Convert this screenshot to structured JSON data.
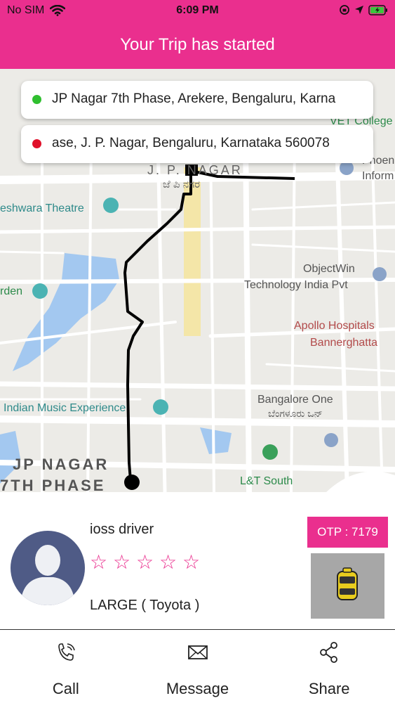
{
  "status_bar": {
    "carrier": "No SIM",
    "time": "6:09 PM"
  },
  "header": {
    "title": "Your Trip has started"
  },
  "trip": {
    "pickup_address": "JP Nagar 7th Phase, Arekere, Bengaluru, Karna",
    "drop_address": "ase, J. P. Nagar, Bengaluru, Karnataka 560078",
    "pickup_dot_color": "#2fbf2f",
    "drop_dot_color": "#e0102a"
  },
  "map": {
    "labels": {
      "jp_nagar": "J. P. NAGAR",
      "jp_nagar_kn": "ಜೆ ಪಿ ನಗರ",
      "theatre": "eshwara Theatre",
      "garden": "rden",
      "objectwin_1": "ObjectWin",
      "objectwin_2": "Technology India Pvt",
      "apollo_1": "Apollo Hospitals",
      "apollo_2": "Bannerghatta",
      "music": "Indian Music Experience",
      "bangalore_one": "Bangalore One",
      "bangalore_one_kn": "ಬೆಂಗಳೂರು ಒನ್",
      "jp7_1": "JP NAGAR",
      "jp7_2": "7TH PHASE",
      "lt_south": "L&T South",
      "phoenix_1": "Phoen",
      "phoenix_2": "Inform",
      "vet_college": "VET College"
    }
  },
  "driver": {
    "name": "ioss driver",
    "rating_stars": [
      "☆",
      "☆",
      "☆",
      "☆",
      "☆"
    ],
    "vehicle": "LARGE ( Toyota )",
    "otp": "OTP : 7179"
  },
  "actions": {
    "call": "Call",
    "message": "Message",
    "share": "Share"
  },
  "colors": {
    "accent": "#ea2f8e",
    "avatar_bg": "#4f5b86",
    "vehicle_bg": "#a7a7a7"
  }
}
